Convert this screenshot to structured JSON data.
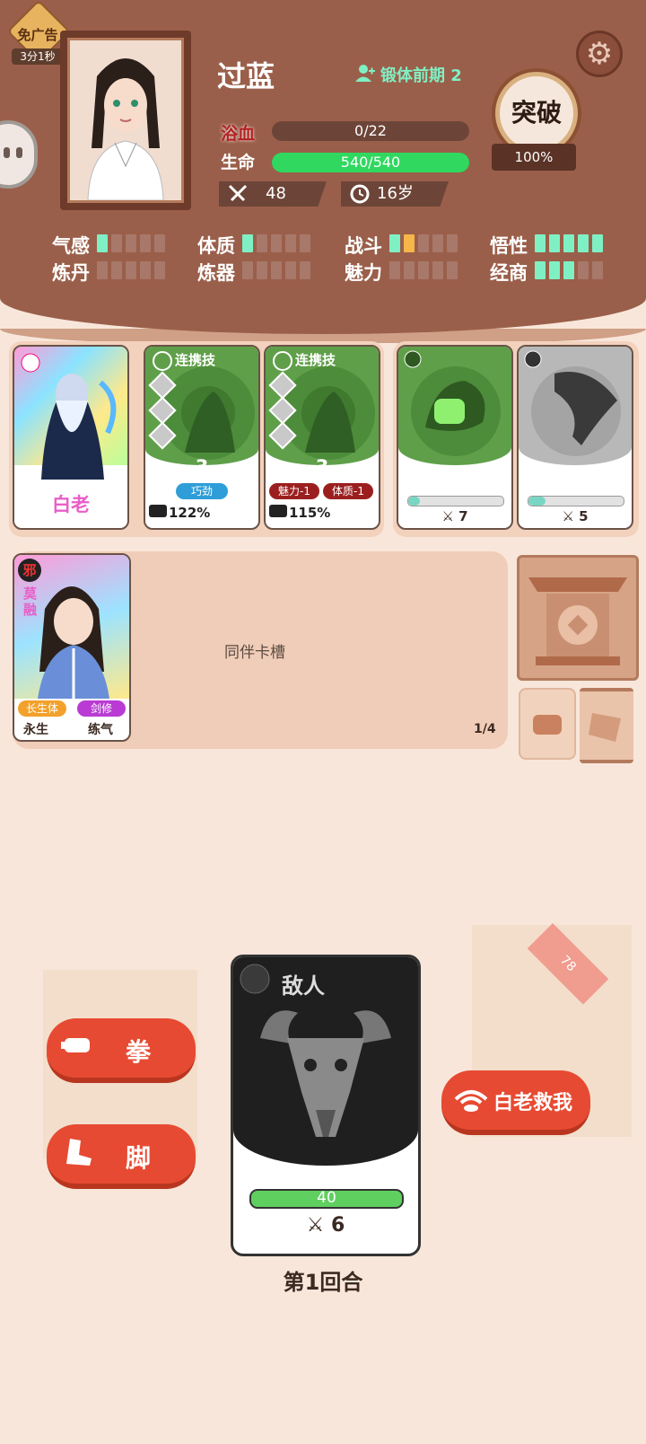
{
  "no_ad": {
    "label": "免广告",
    "timer": "3分1秒"
  },
  "player": {
    "name": "过蓝",
    "realm": "锻体前期 2",
    "bathing": {
      "label": "浴血",
      "value": "0/22",
      "fraction": 0
    },
    "life": {
      "label": "生命",
      "value": "540/540",
      "fraction": 1
    },
    "attack": "48",
    "age": "16岁"
  },
  "breakthrough": {
    "label": "突破",
    "percent": "100%"
  },
  "attributes": [
    {
      "label": "气感",
      "level": 1,
      "max": 5
    },
    {
      "label": "体质",
      "level": 1,
      "max": 5
    },
    {
      "label": "战斗",
      "level": 2,
      "max": 5
    },
    {
      "label": "悟性",
      "level": 5,
      "max": 5
    },
    {
      "label": "炼丹",
      "level": 0,
      "max": 5
    },
    {
      "label": "炼器",
      "level": 0,
      "max": 5
    },
    {
      "label": "魅力",
      "level": 0,
      "max": 5
    },
    {
      "label": "经商",
      "level": 3,
      "max": 5
    }
  ],
  "cards": {
    "mentor": {
      "name": "白老"
    },
    "combo1": {
      "header": "连携技",
      "count": "3",
      "tags": [
        "巧劲"
      ],
      "pct": "122%"
    },
    "combo2": {
      "header": "连携技",
      "count": "3",
      "tags": [
        "魅力-1",
        "体质-1"
      ],
      "pct": "115%"
    },
    "fist": {
      "name": "拳",
      "atk": "7",
      "progress": 0.12
    },
    "kick": {
      "name": "脚",
      "atk": "5",
      "progress": 0.18
    }
  },
  "companion": {
    "badge": "邪",
    "name": "莫融",
    "tags": [
      "长生体",
      "剑修"
    ],
    "stats": [
      "永生",
      "练气"
    ],
    "slot_label": "同伴卡槽",
    "count": "1/4"
  },
  "battle": {
    "fist_button": "拳",
    "kick_button": "脚",
    "rescue_button": "白老救我",
    "deck_count": "78",
    "enemy": {
      "title": "敌人",
      "hp": "40",
      "atk": "6",
      "hp_fraction": 1
    },
    "round": "第1回合"
  },
  "colors": {
    "header": "#9a5f4a",
    "green": "#30d860",
    "accent": "#7ff0c4",
    "red": "#e74a32"
  }
}
